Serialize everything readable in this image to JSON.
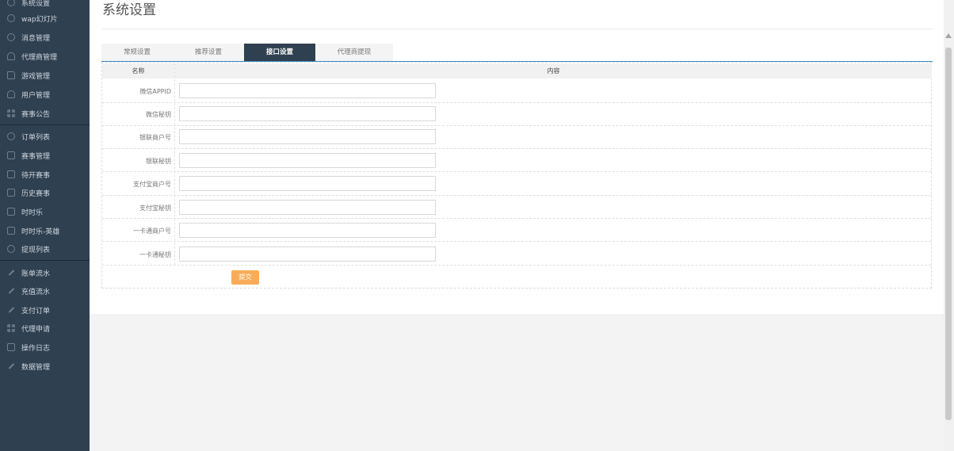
{
  "page": {
    "title": "系统设置"
  },
  "sidebar": {
    "items": [
      {
        "label": "系统设置",
        "icon": "gear-icon"
      },
      {
        "label": "wap幻灯片",
        "icon": "gear-icon"
      },
      {
        "label": "消息管理",
        "icon": "gear-icon"
      },
      {
        "label": "代理商管理",
        "icon": "user-icon"
      },
      {
        "label": "游戏管理",
        "icon": "document-icon"
      },
      {
        "label": "用户管理",
        "icon": "users-icon"
      },
      {
        "label": "赛事公告",
        "icon": "grid-icon"
      },
      {
        "label": "订单列表",
        "icon": "clock-icon"
      },
      {
        "label": "赛事管理",
        "icon": "calendar-icon"
      },
      {
        "label": "待开赛事",
        "icon": "calendar-icon"
      },
      {
        "label": "历史赛事",
        "icon": "calendar-icon"
      },
      {
        "label": "时时乐",
        "icon": "calendar-icon"
      },
      {
        "label": "时时乐-英雄",
        "icon": "calendar-icon"
      },
      {
        "label": "提现列表",
        "icon": "refresh-icon"
      },
      {
        "label": "账单流水",
        "icon": "link-icon"
      },
      {
        "label": "充值流水",
        "icon": "link-icon"
      },
      {
        "label": "支付订单",
        "icon": "link-icon"
      },
      {
        "label": "代理申请",
        "icon": "grid-icon"
      },
      {
        "label": "操作日志",
        "icon": "square-icon"
      },
      {
        "label": "数据管理",
        "icon": "link-icon"
      }
    ]
  },
  "tabs": [
    {
      "label": "常规设置"
    },
    {
      "label": "推荐设置"
    },
    {
      "label": "接口设置"
    },
    {
      "label": "代理商提现"
    }
  ],
  "table": {
    "headers": {
      "name": "名称",
      "content": "内容"
    },
    "rows": [
      {
        "label": "微信APPID",
        "value": ""
      },
      {
        "label": "微信秘钥",
        "value": ""
      },
      {
        "label": "银联商户号",
        "value": ""
      },
      {
        "label": "银联秘钥",
        "value": ""
      },
      {
        "label": "支付宝商户号",
        "value": ""
      },
      {
        "label": "支付宝秘钥",
        "value": ""
      },
      {
        "label": "一卡通商户号",
        "value": ""
      },
      {
        "label": "一卡通秘钥",
        "value": ""
      }
    ]
  },
  "submit_label": "提交",
  "colors": {
    "sidebar": "#2f4050",
    "accent": "#f8ac59",
    "tab_active": "#2f4050"
  }
}
